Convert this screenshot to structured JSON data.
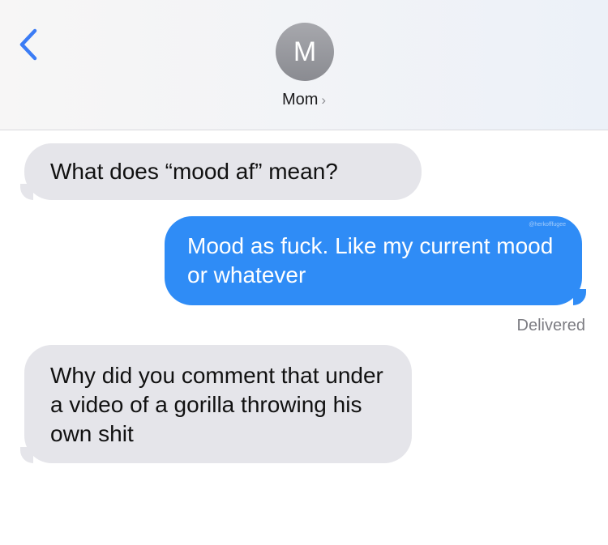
{
  "header": {
    "avatar_initial": "M",
    "contact_name": "Mom",
    "contact_chevron": "›"
  },
  "messages": [
    {
      "direction": "incoming",
      "text": "What does “mood af” mean?"
    },
    {
      "direction": "outgoing",
      "text": "Mood as fuck. Like my current mood or whatever"
    },
    {
      "direction": "incoming",
      "text": "Why did you comment that under a video of a gorilla throwing his own shit"
    }
  ],
  "status": {
    "delivered_label": "Delivered"
  },
  "watermark": "@herkofffugee"
}
